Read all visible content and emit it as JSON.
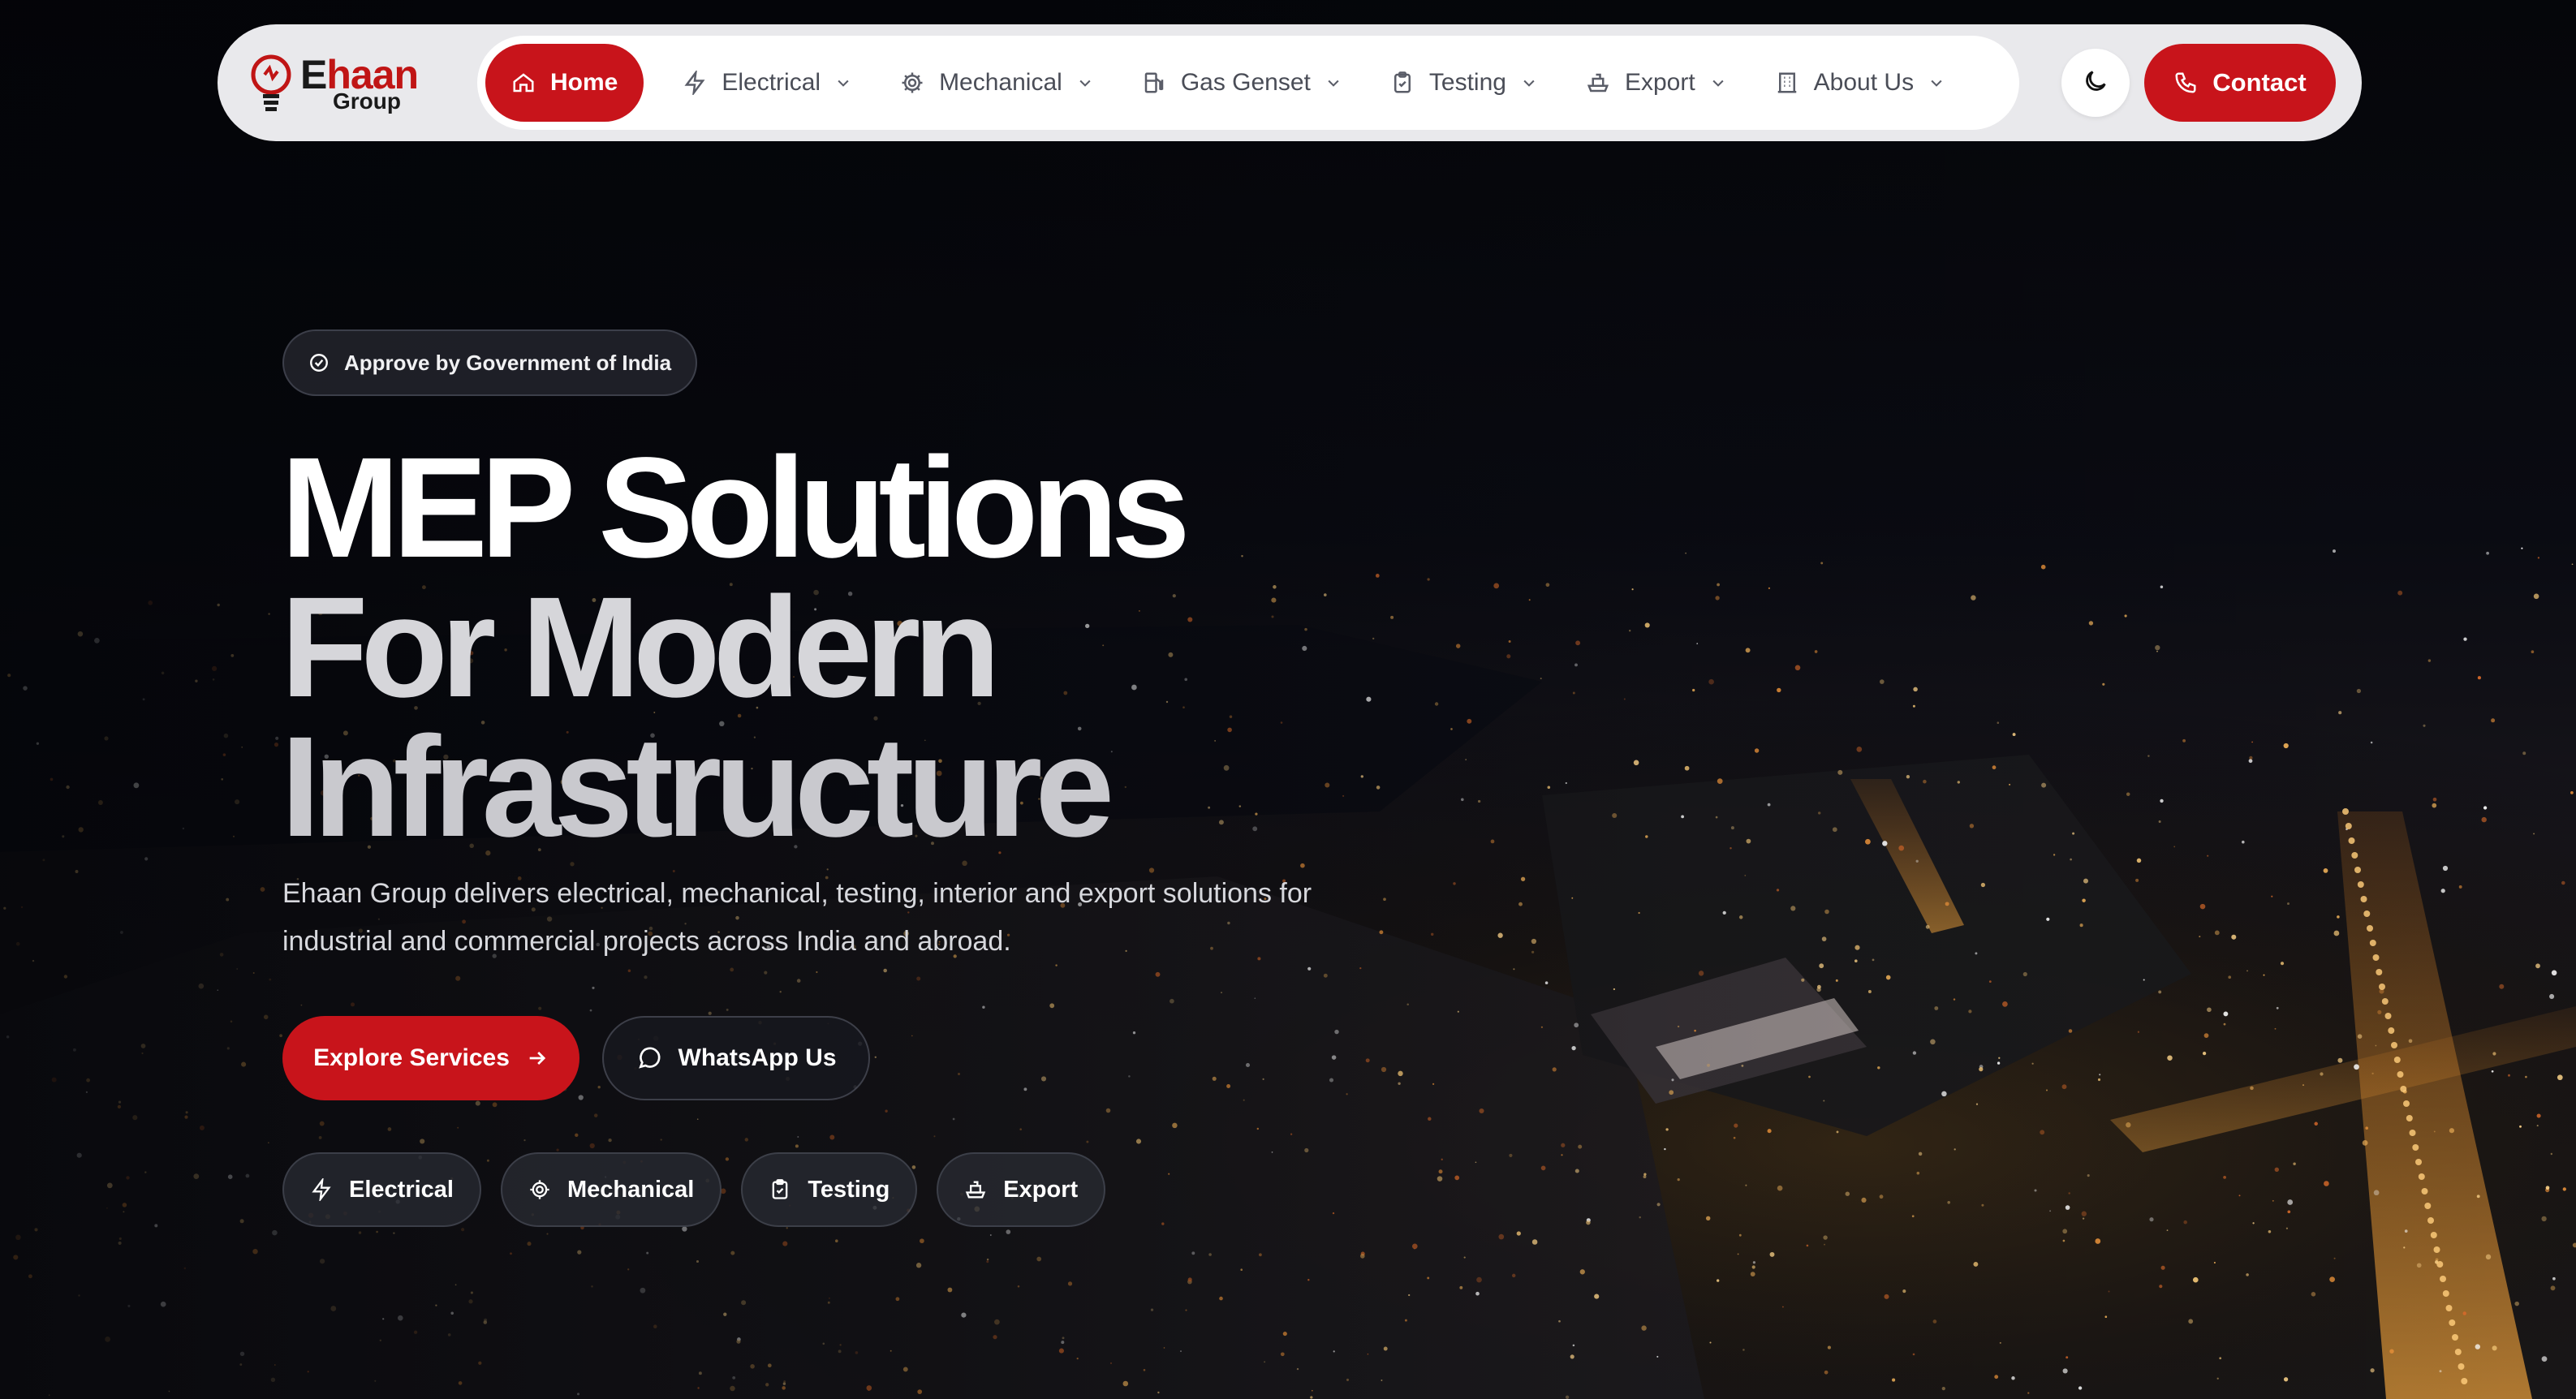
{
  "brand": {
    "logo_main": "haan",
    "logo_initial": "E",
    "logo_sub": "Group",
    "accent_color": "#c8141b"
  },
  "nav": {
    "items": [
      {
        "label": "Home",
        "icon": "home-icon",
        "active": true
      },
      {
        "label": "Electrical",
        "icon": "bolt-icon",
        "dropdown": true
      },
      {
        "label": "Mechanical",
        "icon": "gear-icon",
        "dropdown": true
      },
      {
        "label": "Gas Genset",
        "icon": "fuel-pump-icon",
        "dropdown": true
      },
      {
        "label": "Testing",
        "icon": "clipboard-check-icon",
        "dropdown": true
      },
      {
        "label": "Export",
        "icon": "ship-icon",
        "dropdown": true
      },
      {
        "label": "About Us",
        "icon": "building-icon",
        "dropdown": true
      }
    ],
    "theme_toggle_icon": "moon-icon",
    "contact_label": "Contact"
  },
  "hero": {
    "badge": "Approve by Government of India",
    "title_line1": "MEP Solutions",
    "title_line2": "For Modern",
    "title_line3": "Infrastructure",
    "description": "Ehaan Group delivers electrical, mechanical, testing, interior and export solutions for industrial and commercial projects across India and abroad.",
    "primary_cta": "Explore Services",
    "secondary_cta": "WhatsApp Us",
    "chips": [
      {
        "label": "Electrical",
        "icon": "bolt-icon"
      },
      {
        "label": "Mechanical",
        "icon": "gear-icon"
      },
      {
        "label": "Testing",
        "icon": "clipboard-check-icon"
      },
      {
        "label": "Export",
        "icon": "ship-icon"
      }
    ]
  }
}
